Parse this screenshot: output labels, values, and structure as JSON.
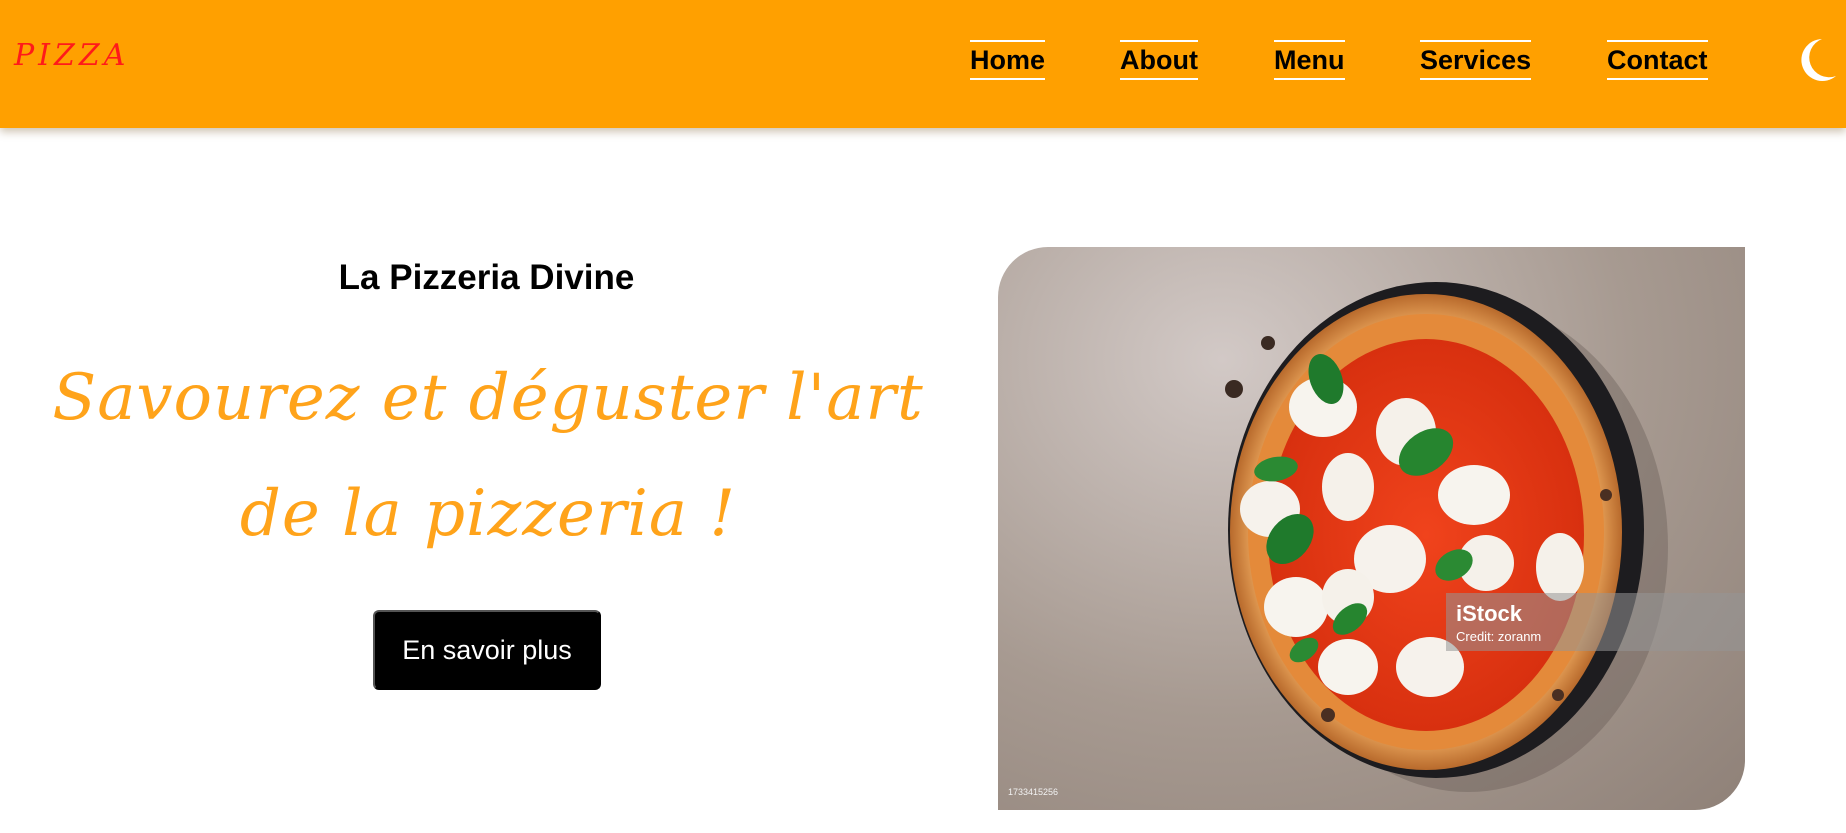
{
  "brand": {
    "logo_text": "PIZZA",
    "logo_color": "#ff1a1a"
  },
  "nav": {
    "items": [
      {
        "label": "Home"
      },
      {
        "label": "About"
      },
      {
        "label": "Menu"
      },
      {
        "label": "Services"
      },
      {
        "label": "Contact"
      }
    ],
    "theme_toggle_icon": "moon-icon"
  },
  "hero": {
    "title": "La Pizzeria Divine",
    "slogan": "Savourez et déguster l'art de la pizzeria !",
    "cta_label": "En savoir plus",
    "image": {
      "watermark": "iStock",
      "credit": "Credit: zoranm",
      "stock_id": "1733415256"
    }
  },
  "colors": {
    "navbar_background": "#ffa000",
    "slogan": "#ffa31a",
    "button_background": "#000000",
    "button_text": "#ffffff"
  }
}
